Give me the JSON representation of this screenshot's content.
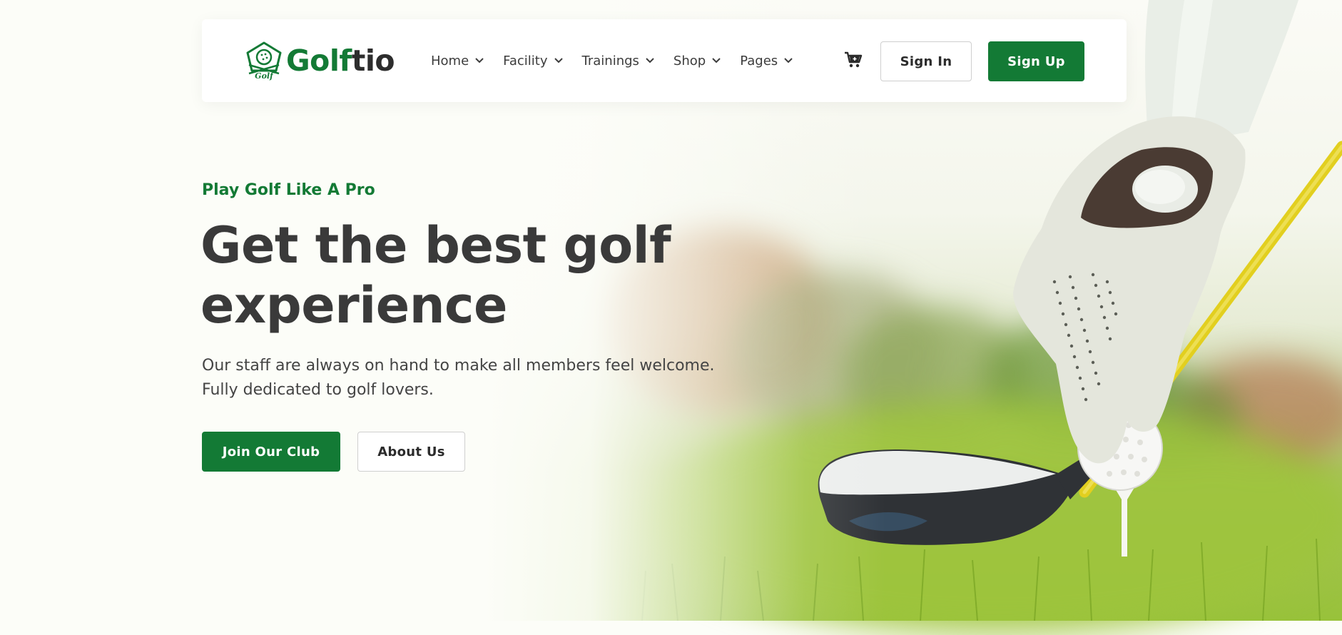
{
  "brand": {
    "name_part1": "Golf",
    "name_part2": "tio",
    "badge_text": "Golf",
    "primary_color": "#137a35",
    "text_color": "#2d2d2d"
  },
  "nav": {
    "items": [
      {
        "label": "Home",
        "icon": "chevron-down-icon"
      },
      {
        "label": "Facility",
        "icon": "chevron-down-icon"
      },
      {
        "label": "Trainings",
        "icon": "chevron-down-icon"
      },
      {
        "label": "Shop",
        "icon": "chevron-down-icon"
      },
      {
        "label": "Pages",
        "icon": "chevron-down-icon"
      }
    ],
    "cart_icon": "cart-icon",
    "sign_in_label": "Sign In",
    "sign_up_label": "Sign Up"
  },
  "hero": {
    "eyebrow": "Play Golf Like A Pro",
    "headline_line1": "Get the best golf",
    "headline_line2": "experience",
    "subtitle_line1": "Our staff are always on hand to make all members feel welcome.",
    "subtitle_line2": "Fully dedicated to golf lovers.",
    "primary_cta": "Join Our Club",
    "secondary_cta": "About Us",
    "image": "golfer-gloved-hand-placing-ball-on-tee"
  }
}
